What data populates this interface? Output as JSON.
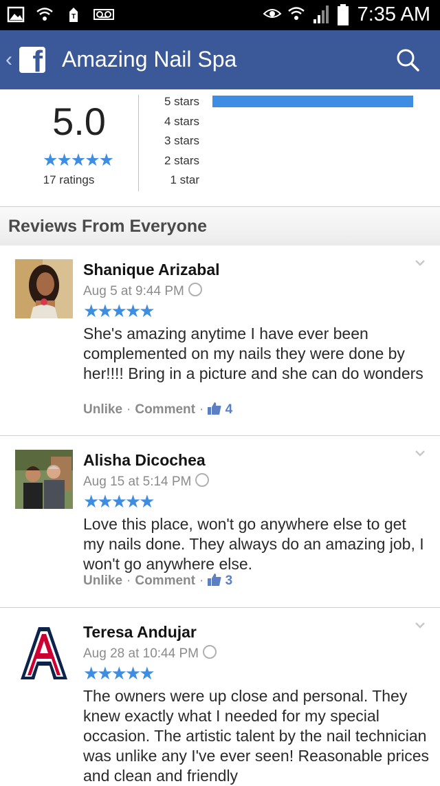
{
  "status_bar": {
    "time": "7:35 AM",
    "left_icons": [
      "image-icon",
      "wifi-icon",
      "t-mobile-icon",
      "voicemail-icon"
    ],
    "right_icons": [
      "eye-icon",
      "wifi-icon",
      "signal-icon",
      "battery-icon"
    ]
  },
  "navbar": {
    "back_glyph": "‹",
    "logo_glyph": "f",
    "title": "Amazing Nail Spa",
    "search_icon": "search-icon",
    "color": "#3b5998"
  },
  "rating_summary": {
    "average": "5.0",
    "stars_glyph": "★★★★★",
    "ratings_count": "17 ratings",
    "breakdown": [
      {
        "label": "5 stars",
        "fraction": 1.0
      },
      {
        "label": "4 stars",
        "fraction": 0
      },
      {
        "label": "3 stars",
        "fraction": 0
      },
      {
        "label": "2 stars",
        "fraction": 0
      },
      {
        "label": "1 star",
        "fraction": 0
      }
    ],
    "bar_color": "#3d8ee3"
  },
  "section_title": "Reviews From Everyone",
  "reviews": [
    {
      "name": "Shanique Arizabal",
      "date": "Aug 5 at 9:44 PM",
      "stars": "★★★★★",
      "text": "She's amazing anytime I have ever been complemented on my nails they were done by her!!!! Bring in a picture and she can do wonders",
      "unlike": "Unlike",
      "comment": "Comment",
      "sep": "·",
      "likes": "4"
    },
    {
      "name": "Alisha Dicochea",
      "date": "Aug 15 at 5:14 PM",
      "stars": "★★★★★",
      "text": "Love this place, won't go anywhere else to get my nails done. They always do an amazing job, I won't go anywhere else.",
      "unlike": "Unlike",
      "comment": "Comment",
      "sep": "·",
      "likes": "3"
    },
    {
      "name": "Teresa Andujar",
      "date": "Aug 28 at 10:44 PM",
      "stars": "★★★★★",
      "text": "The owners were up close and personal. They knew exactly what I needed for my special occasion. The artistic talent by the nail technician was unlike any I've ever seen! Reasonable prices and clean and friendly"
    }
  ]
}
